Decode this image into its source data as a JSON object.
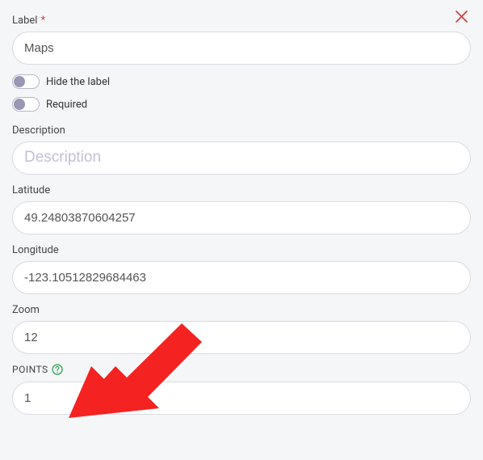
{
  "labels": {
    "label_field": "Label",
    "hide_label": "Hide the label",
    "required": "Required",
    "description": "Description",
    "latitude": "Latitude",
    "longitude": "Longitude",
    "zoom": "Zoom",
    "points": "POINTS"
  },
  "values": {
    "label": "Maps",
    "description": "",
    "latitude": "49.24803870604257",
    "longitude": "-123.10512829684463",
    "zoom": "12",
    "points": "1"
  },
  "placeholders": {
    "description": "Description"
  },
  "toggles": {
    "hide_label": false,
    "required": false
  }
}
